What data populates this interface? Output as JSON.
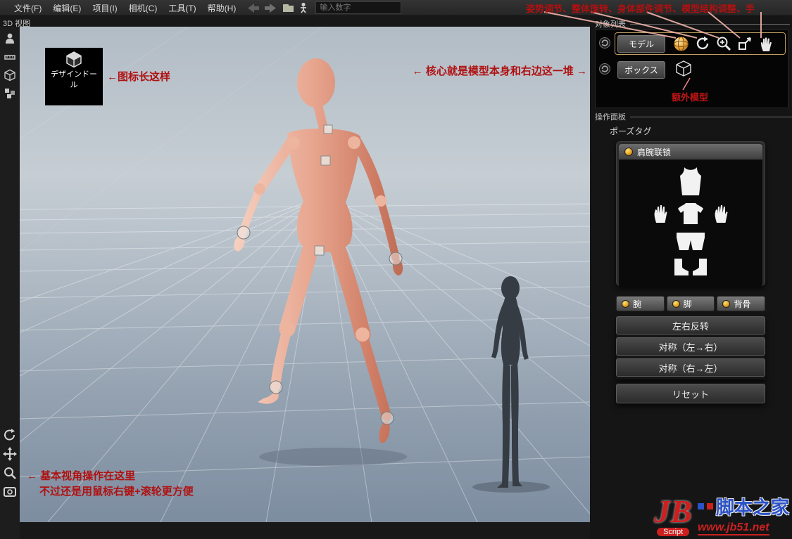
{
  "menu_bar": {
    "items": [
      "文件(F)",
      "编辑(E)",
      "项目(I)",
      "相机(C)",
      "工具(T)",
      "帮助(H)"
    ],
    "number_input_placeholder": "输入数字"
  },
  "view_label": "3D 视图",
  "logo": {
    "line1": "デザインドー",
    "line2": "ル"
  },
  "annotations": {
    "top_toolbar_note": "姿势调节、整体旋转、身体部件调节、模型结构调整、手",
    "logo_note": "←图标长这样",
    "center_note": "← 核心就是模型本身和右边这一堆 →",
    "extra_model_note": "额外模型",
    "bottom_note_line1": "← 基本视角操作在这里",
    "bottom_note_line2": "不过还是用鼠标右键+滚轮更方便"
  },
  "right_panel": {
    "object_list_label": "对象列表",
    "objects": [
      {
        "label": "モデル"
      },
      {
        "label": "ボックス"
      }
    ],
    "operation_panel_label": "操作面板",
    "pose_tag_label": "ポーズタグ",
    "pose_group_title": "肩腕联锁",
    "part_toggles": [
      {
        "label": "腕"
      },
      {
        "label": "脚"
      },
      {
        "label": "背骨"
      }
    ],
    "buttons": [
      {
        "label": "左右反转"
      },
      {
        "label": "对称（左→右）"
      },
      {
        "label": "对称（右→左）"
      }
    ],
    "reset_label": "リセット"
  },
  "watermark": {
    "logo_main": "JB",
    "logo_sub": "Script",
    "site_name": "脚本之家",
    "url": "www.jb51.net"
  },
  "icons": {
    "model_row": [
      "pose-orb-icon",
      "rotate-icon",
      "zoom-plus-icon",
      "structure-icon",
      "hand-icon"
    ],
    "pose_panel": [
      "tanktop-icon",
      "left-hand-icon",
      "shirt-icon",
      "right-hand-icon",
      "shorts-icon",
      "boots-icon"
    ],
    "view_controls": [
      "orbit-view-icon",
      "pan-view-icon",
      "zoom-view-icon",
      "camera-frame-icon"
    ]
  },
  "colors": {
    "annotation_red": "#b01111",
    "highlight_border": "#bf9f63",
    "accent_orange": "#e8a13c",
    "annotation_line_pink": "#f0b4aa"
  }
}
